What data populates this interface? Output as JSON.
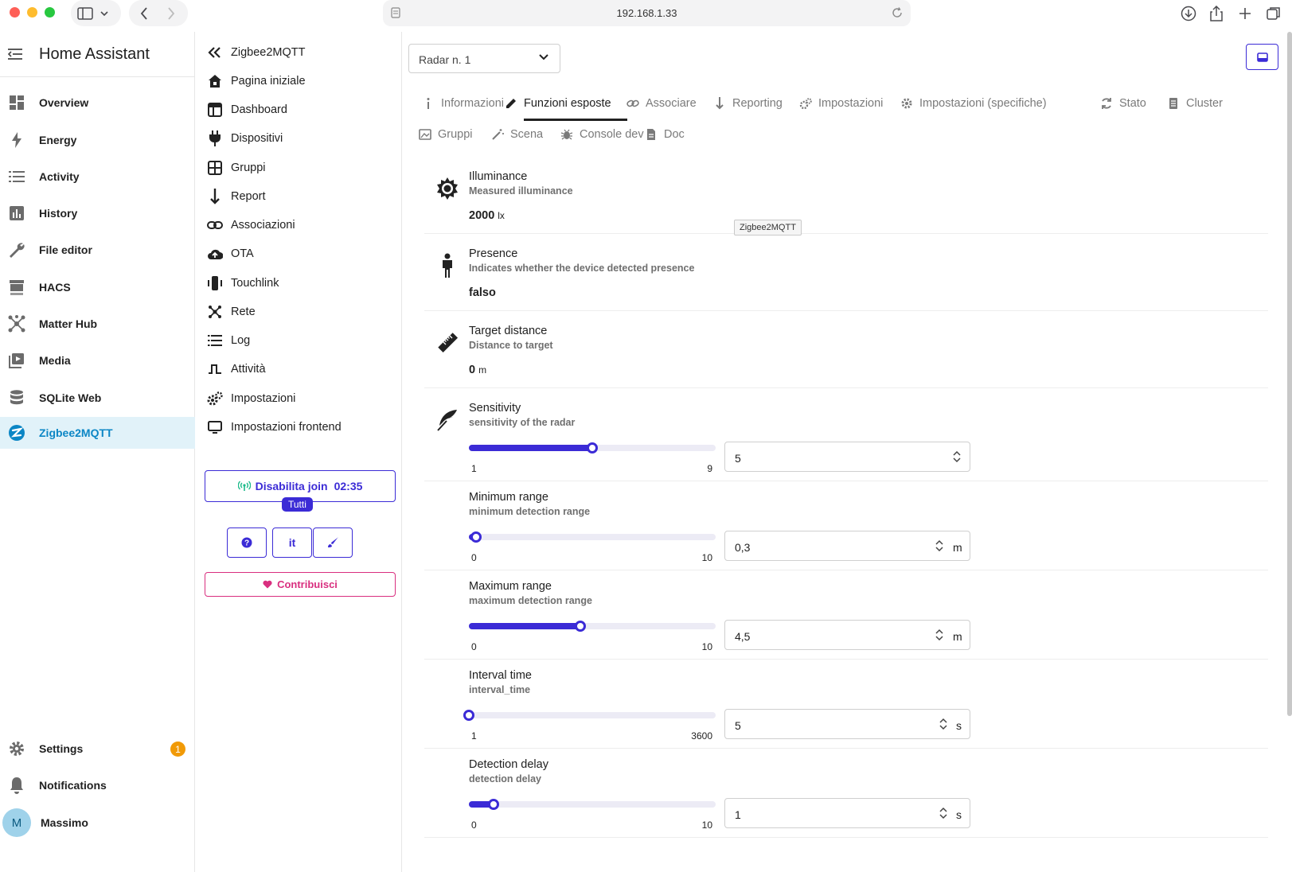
{
  "browser": {
    "url": "192.168.1.33",
    "traffic_colors": [
      "#fe5f57",
      "#febc2e",
      "#28c840"
    ]
  },
  "ha_sidebar": {
    "title": "Home Assistant",
    "items": [
      {
        "label": "Overview",
        "icon": "dashboard-icon"
      },
      {
        "label": "Energy",
        "icon": "lightning-icon"
      },
      {
        "label": "Activity",
        "icon": "list-icon"
      },
      {
        "label": "History",
        "icon": "chart-icon"
      },
      {
        "label": "File editor",
        "icon": "wrench-icon"
      },
      {
        "label": "HACS",
        "icon": "store-icon"
      },
      {
        "label": "Matter Hub",
        "icon": "network-icon"
      },
      {
        "label": "Media",
        "icon": "media-icon"
      },
      {
        "label": "SQLite Web",
        "icon": "database-icon"
      },
      {
        "label": "Zigbee2MQTT",
        "icon": "zigbee-icon"
      }
    ],
    "settings": {
      "label": "Settings",
      "badge": "1"
    },
    "notifications": {
      "label": "Notifications"
    },
    "user": {
      "initial": "M",
      "name": "Massimo"
    }
  },
  "z2m_sidebar": {
    "items": [
      {
        "label": "Zigbee2MQTT",
        "icon": "double-chevron-left-icon"
      },
      {
        "label": "Pagina iniziale",
        "icon": "home-icon"
      },
      {
        "label": "Dashboard",
        "icon": "dashboard-icon"
      },
      {
        "label": "Dispositivi",
        "icon": "plug-icon"
      },
      {
        "label": "Gruppi",
        "icon": "grid-icon"
      },
      {
        "label": "Report",
        "icon": "arrow-down-icon"
      },
      {
        "label": "Associazioni",
        "icon": "link-icon"
      },
      {
        "label": "OTA",
        "icon": "cloud-upload-icon"
      },
      {
        "label": "Touchlink",
        "icon": "touchlink-icon"
      },
      {
        "label": "Rete",
        "icon": "network-icon"
      },
      {
        "label": "Log",
        "icon": "list-icon"
      },
      {
        "label": "Attività",
        "icon": "pulse-icon"
      },
      {
        "label": "Impostazioni",
        "icon": "gears-icon"
      },
      {
        "label": "Impostazioni frontend",
        "icon": "monitor-icon"
      }
    ],
    "join_button": {
      "label": "Disabilita join",
      "time": "02:35"
    },
    "join_target": "Tutti",
    "help_label": "?",
    "lang_label": "it",
    "contribute_label": "Contribuisci"
  },
  "main": {
    "device_select": "Radar n. 1",
    "tabs": [
      {
        "label": "Informazioni",
        "icon": "info-icon"
      },
      {
        "label": "Funzioni esposte",
        "icon": "pencil-icon",
        "active": true
      },
      {
        "label": "Associare",
        "icon": "link-icon"
      },
      {
        "label": "Reporting",
        "icon": "arrow-down-icon"
      },
      {
        "label": "Impostazioni",
        "icon": "gears-icon"
      },
      {
        "label": "Impostazioni (specifiche)",
        "icon": "gear-icon"
      },
      {
        "label": "Stato",
        "icon": "refresh-icon"
      },
      {
        "label": "Cluster",
        "icon": "document-icon"
      },
      {
        "label": "Gruppi",
        "icon": "image-icon"
      },
      {
        "label": "Scena",
        "icon": "wand-icon"
      },
      {
        "label": "Console dev",
        "icon": "bug-icon"
      },
      {
        "label": "Doc",
        "icon": "file-icon"
      }
    ],
    "tooltip": "Zigbee2MQTT",
    "features": [
      {
        "title": "Illuminance",
        "desc": "Measured illuminance",
        "value": "2000",
        "unit": "lx",
        "icon": "sun-icon"
      },
      {
        "title": "Presence",
        "desc": "Indicates whether the device detected presence",
        "value": "falso",
        "unit": "",
        "icon": "person-icon"
      },
      {
        "title": "Target distance",
        "desc": "Distance to target",
        "value": "0",
        "unit": "m",
        "icon": "ruler-icon"
      },
      {
        "title": "Sensitivity",
        "desc": "sensitivity of the radar",
        "min": "1",
        "max": "9",
        "value": "5",
        "unit": "",
        "level": 0.5,
        "icon": "feather-icon"
      },
      {
        "title": "Minimum range",
        "desc": "minimum detection range",
        "min": "0",
        "max": "10",
        "value": "0,3",
        "unit": "m",
        "level": 0.03
      },
      {
        "title": "Maximum range",
        "desc": "maximum detection range",
        "min": "0",
        "max": "10",
        "value": "4,5",
        "unit": "m",
        "level": 0.45
      },
      {
        "title": "Interval time",
        "desc": "interval_time",
        "min": "1",
        "max": "3600",
        "value": "5",
        "unit": "s",
        "level": 0.001
      },
      {
        "title": "Detection delay",
        "desc": "detection delay",
        "min": "0",
        "max": "10",
        "value": "1",
        "unit": "s",
        "level": 0.1
      }
    ]
  },
  "colors": {
    "accent": "#3b2bd6",
    "ha_active": "#0b86c5",
    "contribute": "#d92f7f",
    "badge": "#f19a07"
  }
}
